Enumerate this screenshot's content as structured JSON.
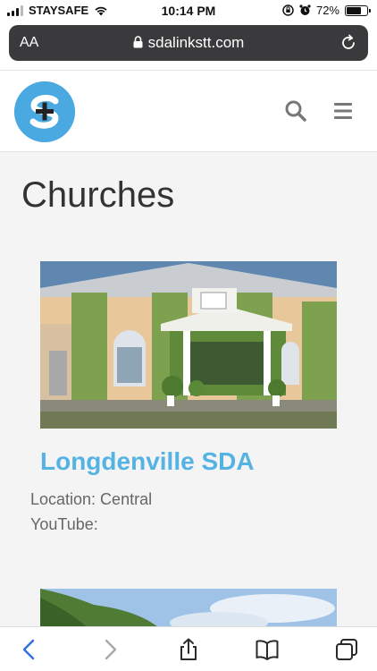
{
  "status_bar": {
    "carrier": "STAYSAFE",
    "time": "10:14 PM",
    "battery_percent": "72%",
    "battery_level": 0.72
  },
  "browser": {
    "text_size_label": "AA",
    "url": "sdalinkstt.com"
  },
  "page": {
    "title": "Churches"
  },
  "churches": [
    {
      "name": "Longdenville SDA",
      "location": "Location: Central",
      "youtube": "YouTube:"
    }
  ],
  "icons": {
    "logo": "sdalinks-logo",
    "search": "search-icon",
    "menu": "hamburger-menu-icon",
    "back": "back-chevron-icon",
    "forward": "forward-chevron-icon",
    "share": "share-icon",
    "bookmarks": "bookmarks-icon",
    "tabs": "tabs-icon"
  },
  "colors": {
    "accent": "#55b3e3",
    "logo": "#4aa9e0",
    "url_bar": "#3a3a3c"
  }
}
